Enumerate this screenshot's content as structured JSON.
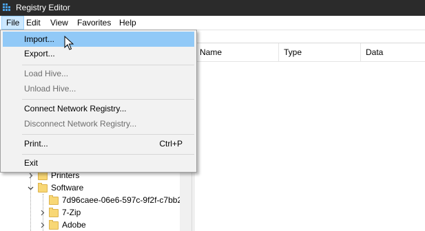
{
  "window": {
    "title": "Registry Editor"
  },
  "menubar": {
    "items": [
      {
        "label": "File"
      },
      {
        "label": "Edit"
      },
      {
        "label": "View"
      },
      {
        "label": "Favorites"
      },
      {
        "label": "Help"
      }
    ]
  },
  "file_menu": {
    "items": [
      {
        "label": "Import...",
        "shortcut": "",
        "enabled": true,
        "highlighted": true
      },
      {
        "label": "Export...",
        "shortcut": "",
        "enabled": true
      },
      {
        "label": "Load Hive...",
        "shortcut": "",
        "enabled": false
      },
      {
        "label": "Unload Hive...",
        "shortcut": "",
        "enabled": false
      },
      {
        "label": "Connect Network Registry...",
        "shortcut": "",
        "enabled": true
      },
      {
        "label": "Disconnect Network Registry...",
        "shortcut": "",
        "enabled": false
      },
      {
        "label": "Print...",
        "shortcut": "Ctrl+P",
        "enabled": true
      },
      {
        "label": "Exit",
        "shortcut": "",
        "enabled": true
      }
    ]
  },
  "list_view": {
    "columns": [
      {
        "label": "Name"
      },
      {
        "label": "Type"
      },
      {
        "label": "Data"
      }
    ]
  },
  "tree": {
    "nodes": [
      {
        "label": "Printers",
        "expanded": false
      },
      {
        "label": "Software",
        "expanded": true
      },
      {
        "label": "7d96caee-06e6-597c-9f2f-c7bb2",
        "expanded": false
      },
      {
        "label": "7-Zip",
        "expanded": false
      },
      {
        "label": "Adobe",
        "expanded": false
      }
    ]
  },
  "colors": {
    "titlebar": "#2b2b2b",
    "menu_highlight": "#91c9f7",
    "folder": "#f8d775",
    "disabled_text": "#6d6d6d"
  }
}
